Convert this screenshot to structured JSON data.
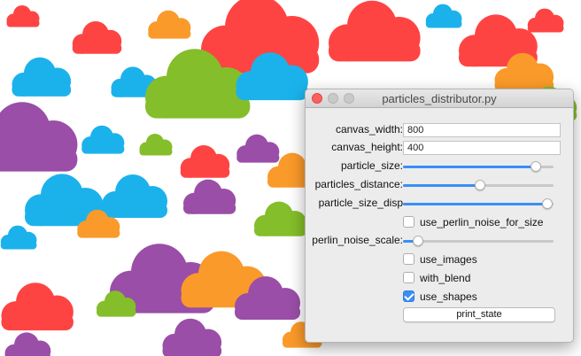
{
  "window": {
    "title": "particles_distributor.py"
  },
  "controls": {
    "canvas_width": {
      "label": "canvas_width:",
      "value": "800"
    },
    "canvas_height": {
      "label": "canvas_height:",
      "value": "400"
    },
    "particle_size": {
      "label": "particle_size:",
      "level": 0.88
    },
    "particles_distance": {
      "label": "particles_distance:",
      "level": 0.51
    },
    "particle_size_disp": {
      "label": "particle_size_disp",
      "level": 0.96
    },
    "use_perlin_noise_for_size": {
      "label": "use_perlin_noise_for_size",
      "checked": false
    },
    "perlin_noise_scale": {
      "label": "perlin_noise_scale:",
      "level": 0.1
    },
    "use_images": {
      "label": "use_images",
      "checked": false
    },
    "with_blend": {
      "label": "with_blend",
      "checked": false
    },
    "use_shapes": {
      "label": "use_shapes",
      "checked": true
    },
    "print_state": {
      "label": "print_state"
    }
  },
  "palette": {
    "red": "#fe4443",
    "orange": "#fa9a2a",
    "green": "#84be2a",
    "blue": "#1bb2ec",
    "purple": "#9a4ea7",
    "accent": "#3a8ef6"
  }
}
